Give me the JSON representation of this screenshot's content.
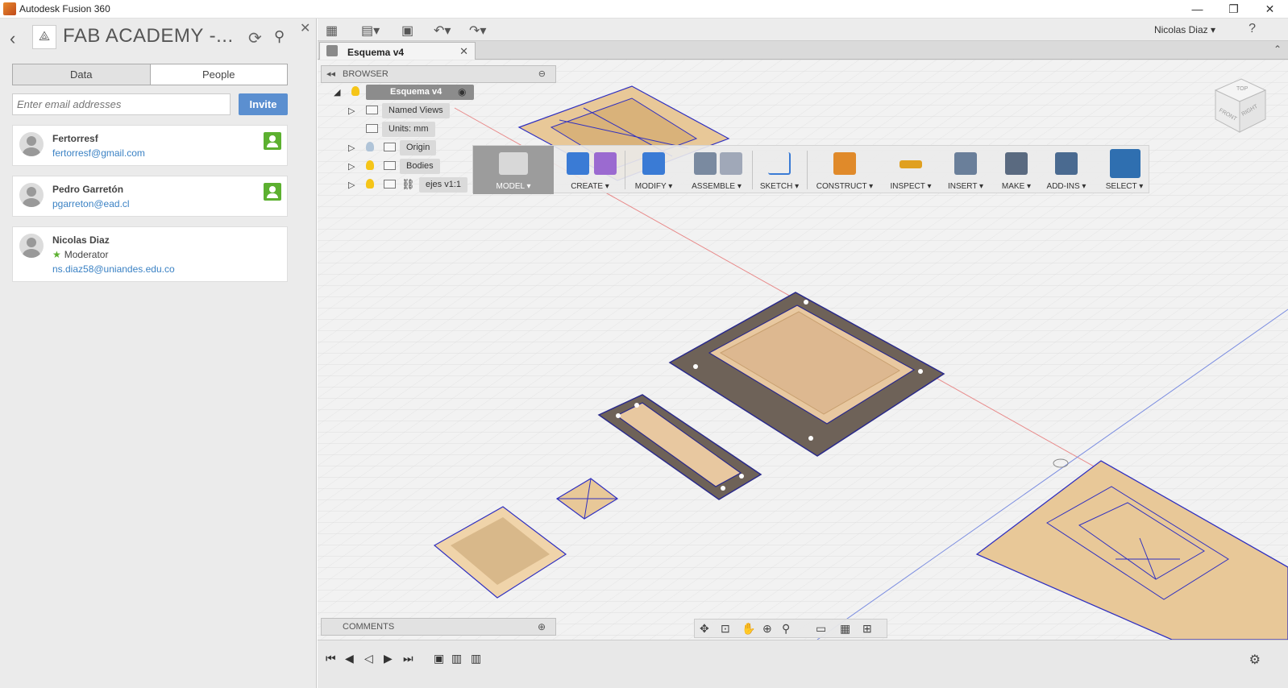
{
  "window": {
    "title": "Autodesk Fusion 360",
    "controls": [
      "—",
      "❐",
      "✕"
    ]
  },
  "left_panel": {
    "project_title": "FAB ACADEMY -...",
    "tabs": {
      "data": "Data",
      "people": "People"
    },
    "email_placeholder": "Enter email addresses",
    "invite_label": "Invite",
    "people": [
      {
        "name": "Fertorresf",
        "email": "fertorresf@gmail.com",
        "role": ""
      },
      {
        "name": "Pedro Garretón",
        "email": "pgarreton@ead.cl",
        "role": ""
      },
      {
        "name": "Nicolas Diaz",
        "email": "ns.diaz58@uniandes.edu.co",
        "role": "Moderator"
      }
    ]
  },
  "app_toolbar": {
    "user_name": "Nicolas Diaz ▾",
    "help": "?"
  },
  "document_tab": {
    "label": "Esquema v4"
  },
  "browser": {
    "header": "BROWSER",
    "items": [
      {
        "label": "Esquema v4"
      },
      {
        "label": "Named Views"
      },
      {
        "label": "Units: mm"
      },
      {
        "label": "Origin"
      },
      {
        "label": "Bodies"
      },
      {
        "label": "ejes v1:1"
      }
    ]
  },
  "toolbar": {
    "model": "MODEL ▾",
    "groups": [
      {
        "label": "CREATE ▾",
        "color": "#3a7bd5"
      },
      {
        "label": "MODIFY ▾",
        "color": "#3a7bd5"
      },
      {
        "label": "ASSEMBLE ▾",
        "color": "#7a8aa0"
      },
      {
        "label": "SKETCH ▾",
        "color": "#3a7bd5"
      },
      {
        "label": "CONSTRUCT ▾",
        "color": "#e08a2a"
      },
      {
        "label": "INSPECT ▾",
        "color": "#e0a020"
      },
      {
        "label": "INSERT ▾",
        "color": "#6a7f9a"
      },
      {
        "label": "MAKE ▾",
        "color": "#5a6a80"
      },
      {
        "label": "ADD-INS ▾",
        "color": "#4a6a90"
      },
      {
        "label": "SELECT ▾",
        "color": "#2f6fb0"
      }
    ]
  },
  "comments": {
    "label": "COMMENTS"
  },
  "viewcube": {
    "top": "TOP",
    "front": "FRONT",
    "right": "RIGHT"
  }
}
